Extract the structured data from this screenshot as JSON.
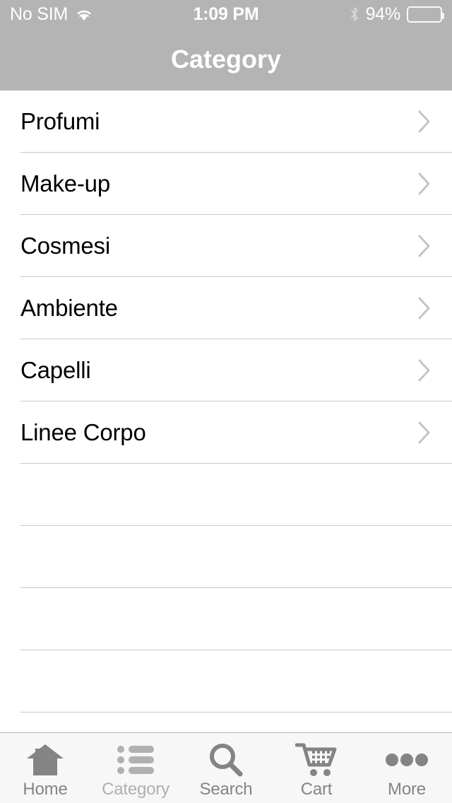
{
  "status_bar": {
    "carrier": "No SIM",
    "wifi_icon": "wifi-icon",
    "time": "1:09 PM",
    "bluetooth_icon": "bluetooth-icon",
    "battery_percent": "94%",
    "battery_level": 94,
    "battery_icon": "battery-icon"
  },
  "navbar": {
    "title": "Category",
    "background_color": "#b4b4b4",
    "title_color": "#ffffff"
  },
  "list": {
    "separator_color": "#c8c8c8",
    "chevron_icon": "chevron-right-icon",
    "items": [
      {
        "label": "Profumi",
        "empty": false
      },
      {
        "label": "Make-up",
        "empty": false
      },
      {
        "label": "Cosmesi",
        "empty": false
      },
      {
        "label": "Ambiente",
        "empty": false
      },
      {
        "label": "Capelli",
        "empty": false
      },
      {
        "label": "Linee Corpo",
        "empty": false
      },
      {
        "label": "",
        "empty": true
      },
      {
        "label": "",
        "empty": true
      },
      {
        "label": "",
        "empty": true
      },
      {
        "label": "",
        "empty": true
      }
    ]
  },
  "tabbar": {
    "background_color": "#f7f7f7",
    "inactive_color": "#848484",
    "active_color": "#b0b0b0",
    "selected_index": 1,
    "tabs": [
      {
        "label": "Home",
        "icon": "home-icon"
      },
      {
        "label": "Category",
        "icon": "list-icon"
      },
      {
        "label": "Search",
        "icon": "search-icon"
      },
      {
        "label": "Cart",
        "icon": "shopping-cart-icon"
      },
      {
        "label": "More",
        "icon": "ellipsis-icon"
      }
    ]
  }
}
